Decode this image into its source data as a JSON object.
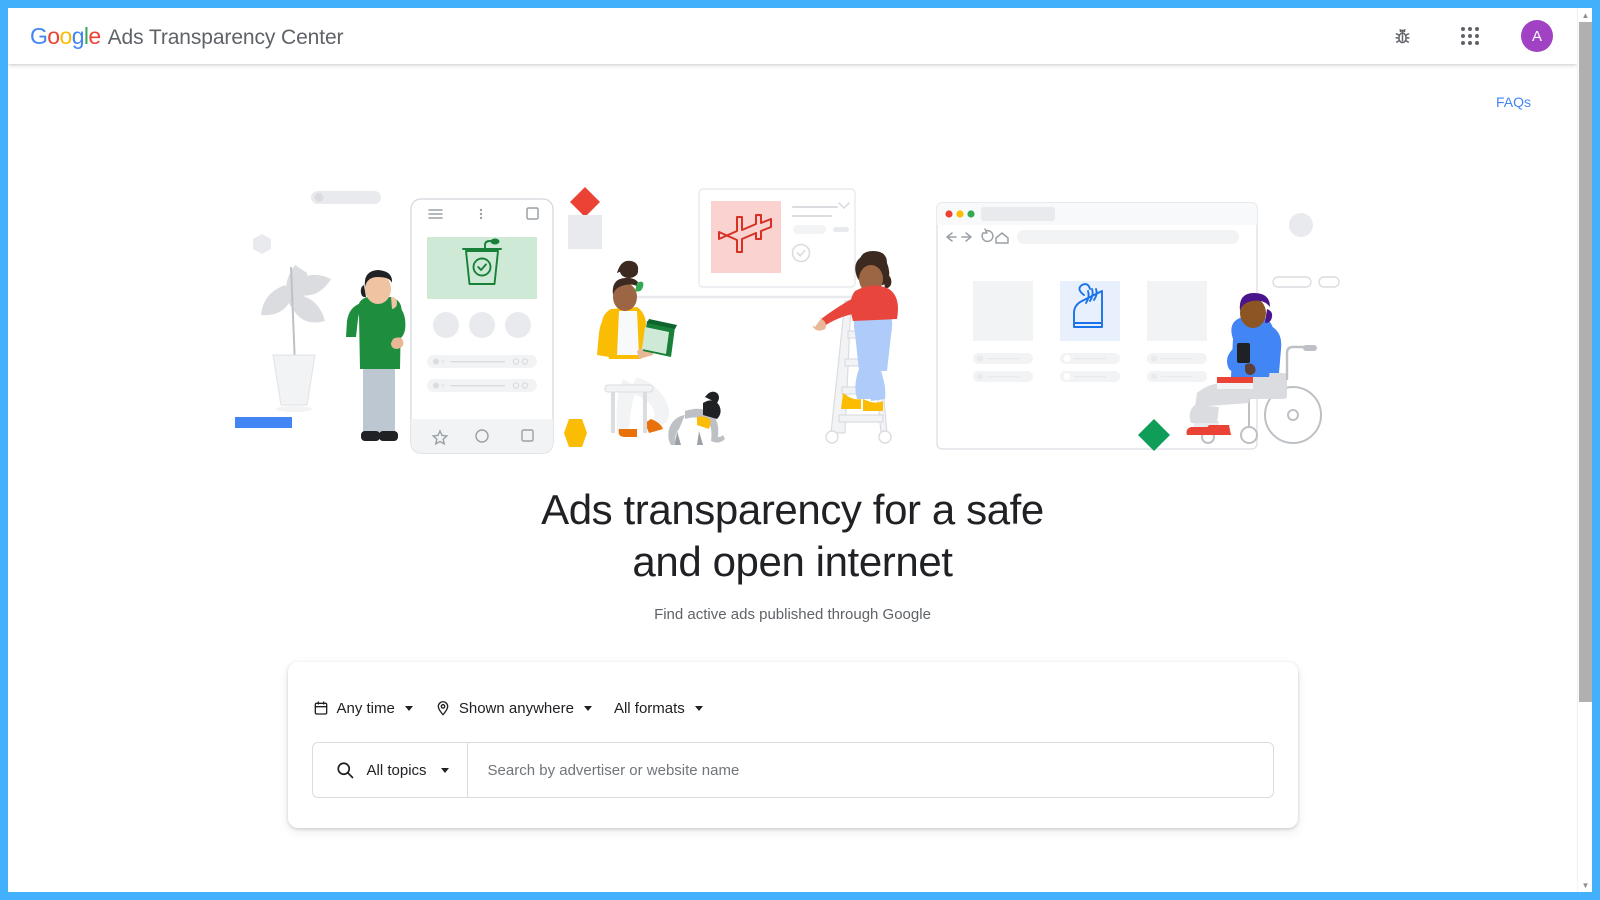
{
  "header": {
    "logo_text": "Google",
    "logo_letters": [
      {
        "char": "G",
        "color": "#4285f4"
      },
      {
        "char": "o",
        "color": "#ea4335"
      },
      {
        "char": "o",
        "color": "#fbbc05"
      },
      {
        "char": "g",
        "color": "#4285f4"
      },
      {
        "char": "l",
        "color": "#34a853"
      },
      {
        "char": "e",
        "color": "#ea4335"
      }
    ],
    "product_name": "Ads Transparency Center",
    "bug_icon": "bug-report-icon",
    "apps_icon": "google-apps-grid-icon",
    "avatar_initial": "A",
    "avatar_color": "#a142c4"
  },
  "page": {
    "faq_label": "FAQs",
    "faq_color": "#4285f4",
    "headline_line1": "Ads transparency for a safe",
    "headline_line2": "and open internet",
    "subtitle": "Find active ads published through Google"
  },
  "search": {
    "filters": [
      {
        "id": "time",
        "icon": "calendar-icon",
        "label": "Any time"
      },
      {
        "id": "region",
        "icon": "location-pin-icon",
        "label": "Shown anywhere"
      },
      {
        "id": "format",
        "icon": "none",
        "label": "All formats"
      }
    ],
    "search_icon": "search-icon",
    "topic_label": "All topics",
    "placeholder": "Search by advertiser or website name",
    "value": ""
  },
  "illustration": {
    "alt": "People interacting with ads on phone, whiteboard and browser",
    "shapes": {
      "blue_rect": "#4285f4",
      "red_diamond": "#ea4335",
      "yellow_hexagon": "#fbbc04",
      "green_diamond": "#0f9d58",
      "gray": "#e8eaed"
    },
    "phone_banner_icon": "podium-check-icon",
    "whiteboard_icon": "airplane-icon",
    "browser_card_icon": "sneaker-icon"
  },
  "scrollbar": {
    "up_arrow": "▲",
    "down_arrow": "▼"
  }
}
